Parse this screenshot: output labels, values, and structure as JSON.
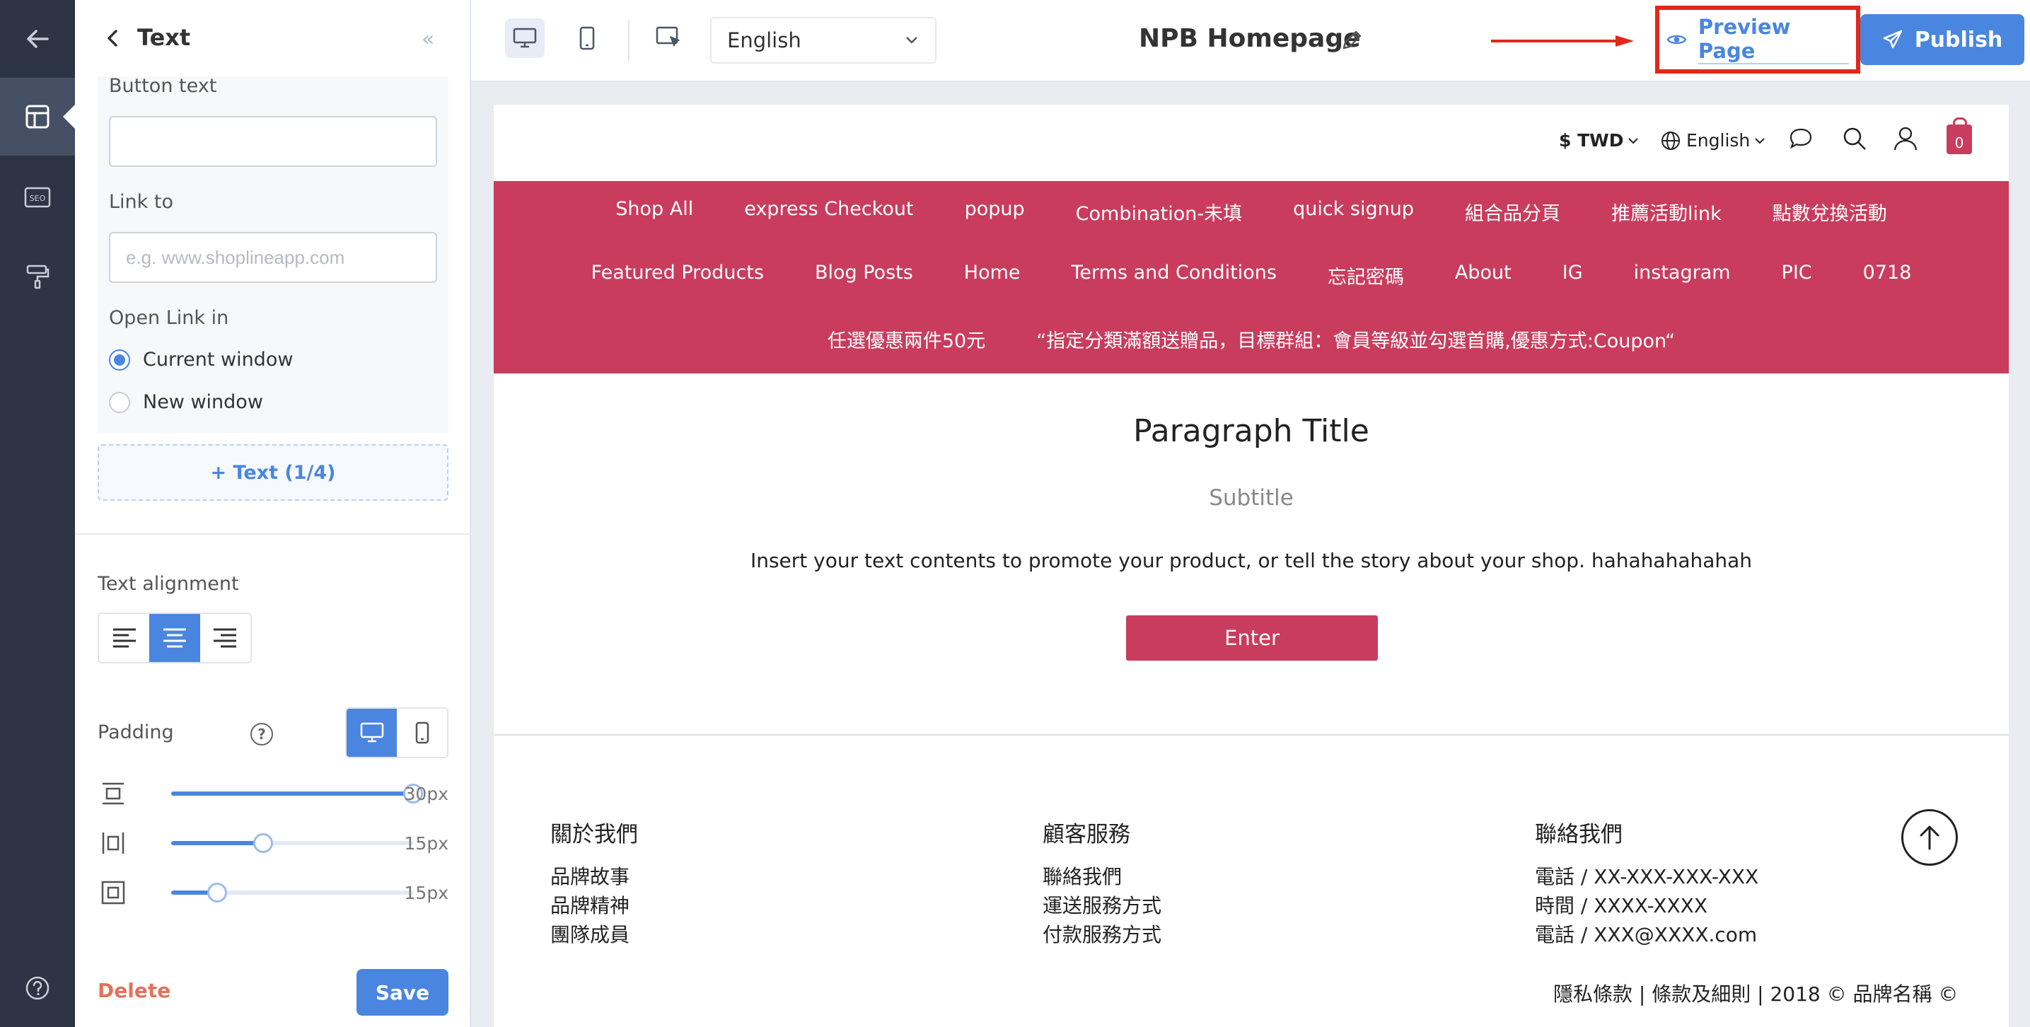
{
  "panel": {
    "title": "Text",
    "button_text_label": "Button text",
    "button_text_value": "",
    "link_to_label": "Link to",
    "link_placeholder": "e.g. www.shoplineapp.com",
    "open_link_label": "Open Link in",
    "open_options": [
      "Current window",
      "New window"
    ],
    "add_text_label": "+ Text (1/4)",
    "text_alignment_label": "Text alignment",
    "padding_label": "Padding",
    "help_glyph": "?",
    "padding": [
      {
        "name": "vertical",
        "value_label": "30px",
        "level": 1.0
      },
      {
        "name": "horizontal",
        "value_label": "15px",
        "level": 0.38
      },
      {
        "name": "all",
        "value_label": "15px",
        "level": 0.19
      }
    ],
    "delete_label": "Delete",
    "save_label": "Save"
  },
  "topbar": {
    "language": "English",
    "page_name": "NPB Homepage",
    "preview_label": "Preview Page",
    "publish_label": "Publish"
  },
  "store": {
    "currency": "$ TWD",
    "language": "English",
    "cart_count": "0",
    "nav_rows": [
      [
        "Shop All",
        "express Checkout",
        "popup",
        "Combination-未填",
        "quick signup",
        "組合品分頁",
        "推薦活動link",
        "點數兌換活動"
      ],
      [
        "Featured Products",
        "Blog Posts",
        "Home",
        "Terms and Conditions",
        "忘記密碼",
        "About",
        "IG",
        "instagram",
        "PIC",
        "0718"
      ],
      [
        "任選優惠兩件50元",
        "“指定分類滿額送贈品，目標群組：會員等級並勾選首購,優惠方式:Coupon“"
      ]
    ],
    "paragraph_title": "Paragraph Title",
    "subtitle": "Subtitle",
    "body_text": "Insert your text contents to promote your product, or tell the story about your shop. hahahahahahah",
    "enter_label": "Enter",
    "footer": {
      "columns": [
        {
          "heading": "關於我們",
          "links": [
            "品牌故事",
            "品牌精神",
            "團隊成員"
          ]
        },
        {
          "heading": "顧客服務",
          "links": [
            "聯絡我們",
            "運送服務方式",
            "付款服務方式"
          ]
        },
        {
          "heading": "聯絡我們",
          "links": [
            "電話 / XX-XXX-XXX-XXX",
            "時間 / XXXX-XXXX",
            "電話 / XXX@XXXX.com"
          ]
        }
      ],
      "copyright": "隱私條款 | 條款及細則 | 2018 © 品牌名稱 ©"
    }
  },
  "colors": {
    "rail": "#2d3443",
    "accent": "#4a86e0",
    "brand": "#c93c5d",
    "highlight": "#e3271b"
  },
  "icons": {
    "rail": [
      "arrow-left-icon",
      "layout-icon",
      "seo-icon",
      "paint-roller-icon",
      "help-icon"
    ],
    "rail_seo_text": "SEO"
  }
}
